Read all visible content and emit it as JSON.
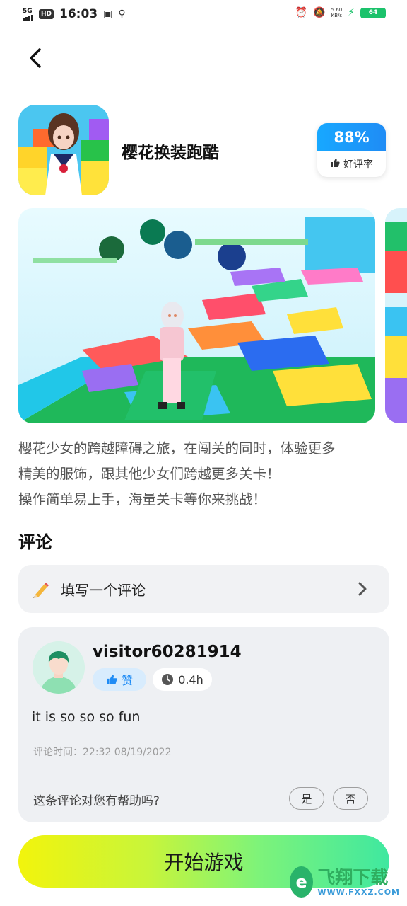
{
  "status_bar": {
    "network": "5G",
    "hd": "HD",
    "time": "16:03",
    "speed_value": "5.60",
    "speed_unit": "KB/s",
    "battery": "64"
  },
  "app": {
    "title": "樱花换装跑酷",
    "rating_value": "88%",
    "rating_label": "好评率"
  },
  "description": [
    "樱花少女的跨越障碍之旅，在闯关的同时，体验更多",
    "精美的服饰，跟其他少女们跨越更多关卡！",
    "操作简单易上手，海量关卡等你来挑战！"
  ],
  "reviews_section": {
    "title": "评论",
    "write_label": "填写一个评论"
  },
  "review": {
    "username": "visitor60281914",
    "like_label": "赞",
    "playtime": "0.4h",
    "text": "it is so so so fun",
    "time_label": "评论时间：22:32 08/19/2022",
    "helpful_question": "这条评论对您有帮助吗?",
    "yes_label": "是",
    "no_label": "否"
  },
  "start_button": "开始游戏",
  "watermark": {
    "main": "飞翔下载",
    "sub": "WWW.FXXZ.COM"
  },
  "colors": {
    "rating_blue": "#1f8cf5",
    "start_gradient_left": "#f2f40c",
    "start_gradient_right": "#3fe8a0",
    "card_bg": "#eef0f3"
  }
}
